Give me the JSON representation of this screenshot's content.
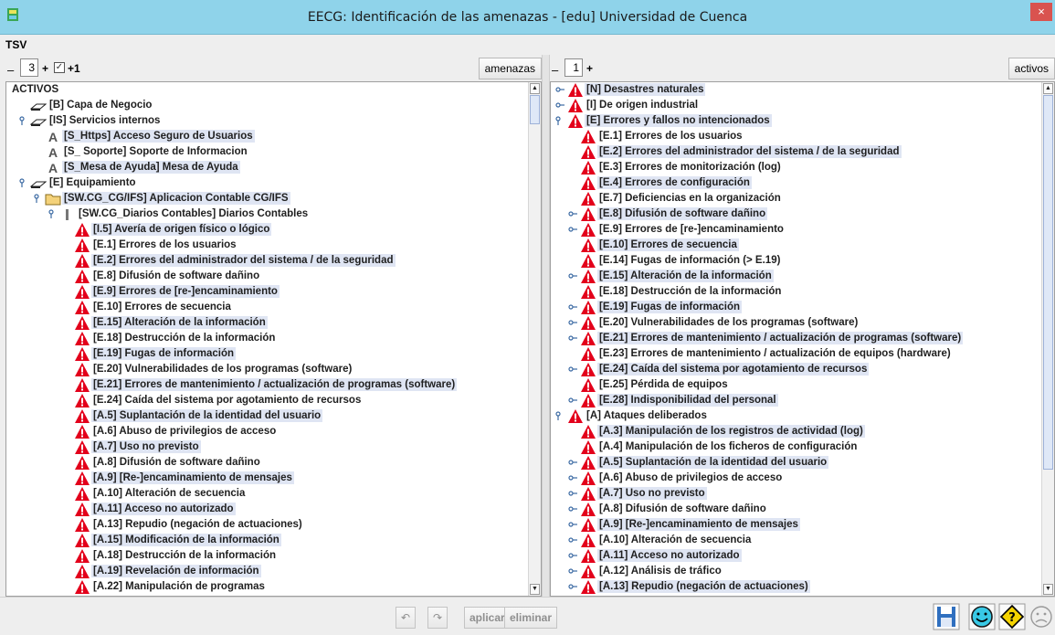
{
  "window": {
    "title": "EECG: Identificación de las amenazas - [edu] Universidad de Cuenca",
    "close_glyph": "×"
  },
  "menubar": {
    "menu": "TSV"
  },
  "left_toolbar": {
    "minus": "–",
    "level": "3",
    "plus": "+",
    "check_glyph": "✓",
    "plus_one": "+1",
    "button": "amenazas"
  },
  "right_toolbar": {
    "minus": "–",
    "level": "1",
    "plus": "+",
    "button": "activos"
  },
  "left_tree": {
    "rows": [
      {
        "label": "ACTIVOS",
        "depth": 0,
        "icon": "none",
        "toggle": "none",
        "hl": false
      },
      {
        "label": "[B] Capa de Negocio",
        "depth": 1,
        "icon": "layer",
        "toggle": "none",
        "hl": false
      },
      {
        "label": "[IS] Servicios internos",
        "depth": 1,
        "icon": "layer",
        "toggle": "open",
        "hl": false
      },
      {
        "label": "[S_Https] Acceso Seguro de Usuarios",
        "depth": 2,
        "icon": "a",
        "toggle": "none",
        "hl": true
      },
      {
        "label": "[S_ Soporte] Soporte de Informacion",
        "depth": 2,
        "icon": "a",
        "toggle": "none",
        "hl": false
      },
      {
        "label": "[S_Mesa de Ayuda] Mesa de Ayuda",
        "depth": 2,
        "icon": "a",
        "toggle": "none",
        "hl": true
      },
      {
        "label": "[E] Equipamiento",
        "depth": 1,
        "icon": "layer",
        "toggle": "open",
        "hl": false
      },
      {
        "label": "[SW.CG_CG/IFS] Aplicacion Contable CG/IFS",
        "depth": 2,
        "icon": "folder",
        "toggle": "open",
        "hl": true
      },
      {
        "label": "[SW.CG_Diarios Contables] Diarios Contables",
        "depth": 3,
        "icon": "bar",
        "toggle": "open",
        "hl": false
      },
      {
        "label": "[I.5] Avería de origen físico o lógico",
        "depth": 4,
        "icon": "warn",
        "toggle": "none",
        "hl": true
      },
      {
        "label": "[E.1] Errores de los usuarios",
        "depth": 4,
        "icon": "warn",
        "toggle": "none",
        "hl": false
      },
      {
        "label": "[E.2] Errores del administrador del sistema / de la seguridad",
        "depth": 4,
        "icon": "warn",
        "toggle": "none",
        "hl": true
      },
      {
        "label": "[E.8] Difusión de software dañino",
        "depth": 4,
        "icon": "warn",
        "toggle": "none",
        "hl": false
      },
      {
        "label": "[E.9] Errores de [re-]encaminamiento",
        "depth": 4,
        "icon": "warn",
        "toggle": "none",
        "hl": true
      },
      {
        "label": "[E.10] Errores de secuencia",
        "depth": 4,
        "icon": "warn",
        "toggle": "none",
        "hl": false
      },
      {
        "label": "[E.15] Alteración de la información",
        "depth": 4,
        "icon": "warn",
        "toggle": "none",
        "hl": true
      },
      {
        "label": "[E.18] Destrucción de la información",
        "depth": 4,
        "icon": "warn",
        "toggle": "none",
        "hl": false
      },
      {
        "label": "[E.19] Fugas de información",
        "depth": 4,
        "icon": "warn",
        "toggle": "none",
        "hl": true
      },
      {
        "label": "[E.20] Vulnerabilidades de los programas (software)",
        "depth": 4,
        "icon": "warn",
        "toggle": "none",
        "hl": false
      },
      {
        "label": "[E.21] Errores de mantenimiento / actualización de programas (software)",
        "depth": 4,
        "icon": "warn",
        "toggle": "none",
        "hl": true
      },
      {
        "label": "[E.24] Caída del sistema por agotamiento de recursos",
        "depth": 4,
        "icon": "warn",
        "toggle": "none",
        "hl": false
      },
      {
        "label": "[A.5] Suplantación de la identidad del usuario",
        "depth": 4,
        "icon": "warn",
        "toggle": "none",
        "hl": true
      },
      {
        "label": "[A.6] Abuso de privilegios de acceso",
        "depth": 4,
        "icon": "warn",
        "toggle": "none",
        "hl": false
      },
      {
        "label": "[A.7] Uso no previsto",
        "depth": 4,
        "icon": "warn",
        "toggle": "none",
        "hl": true
      },
      {
        "label": "[A.8] Difusión de software dañino",
        "depth": 4,
        "icon": "warn",
        "toggle": "none",
        "hl": false
      },
      {
        "label": "[A.9] [Re-]encaminamiento de mensajes",
        "depth": 4,
        "icon": "warn",
        "toggle": "none",
        "hl": true
      },
      {
        "label": "[A.10] Alteración de secuencia",
        "depth": 4,
        "icon": "warn",
        "toggle": "none",
        "hl": false
      },
      {
        "label": "[A.11] Acceso no autorizado",
        "depth": 4,
        "icon": "warn",
        "toggle": "none",
        "hl": true
      },
      {
        "label": "[A.13] Repudio (negación de actuaciones)",
        "depth": 4,
        "icon": "warn",
        "toggle": "none",
        "hl": false
      },
      {
        "label": "[A.15] Modificación de la información",
        "depth": 4,
        "icon": "warn",
        "toggle": "none",
        "hl": true
      },
      {
        "label": "[A.18] Destrucción de la información",
        "depth": 4,
        "icon": "warn",
        "toggle": "none",
        "hl": false
      },
      {
        "label": "[A.19] Revelación de información",
        "depth": 4,
        "icon": "warn",
        "toggle": "none",
        "hl": true
      },
      {
        "label": "[A.22] Manipulación de programas",
        "depth": 4,
        "icon": "warn",
        "toggle": "none",
        "hl": false
      }
    ]
  },
  "right_tree": {
    "rows": [
      {
        "label": "[N] Desastres naturales",
        "depth": 0,
        "icon": "warn",
        "toggle": "closed",
        "hl": true
      },
      {
        "label": "[I] De origen industrial",
        "depth": 0,
        "icon": "warn",
        "toggle": "closed",
        "hl": false
      },
      {
        "label": "[E] Errores y fallos no intencionados",
        "depth": 0,
        "icon": "warn",
        "toggle": "open",
        "hl": true
      },
      {
        "label": "[E.1] Errores de los usuarios",
        "depth": 1,
        "icon": "warn",
        "toggle": "none",
        "hl": false
      },
      {
        "label": "[E.2] Errores del administrador del sistema / de la seguridad",
        "depth": 1,
        "icon": "warn",
        "toggle": "none",
        "hl": true
      },
      {
        "label": "[E.3] Errores de monitorización (log)",
        "depth": 1,
        "icon": "warn",
        "toggle": "none",
        "hl": false
      },
      {
        "label": "[E.4] Errores de configuración",
        "depth": 1,
        "icon": "warn",
        "toggle": "none",
        "hl": true
      },
      {
        "label": "[E.7] Deficiencias en la organización",
        "depth": 1,
        "icon": "warn",
        "toggle": "none",
        "hl": false
      },
      {
        "label": "[E.8] Difusión de software dañino",
        "depth": 1,
        "icon": "warn",
        "toggle": "closed",
        "hl": true
      },
      {
        "label": "[E.9] Errores de [re-]encaminamiento",
        "depth": 1,
        "icon": "warn",
        "toggle": "closed",
        "hl": false
      },
      {
        "label": "[E.10] Errores de secuencia",
        "depth": 1,
        "icon": "warn",
        "toggle": "none",
        "hl": true
      },
      {
        "label": "[E.14] Fugas de información (> E.19)",
        "depth": 1,
        "icon": "warn",
        "toggle": "none",
        "hl": false
      },
      {
        "label": "[E.15] Alteración de la información",
        "depth": 1,
        "icon": "warn",
        "toggle": "closed",
        "hl": true
      },
      {
        "label": "[E.18] Destrucción de la información",
        "depth": 1,
        "icon": "warn",
        "toggle": "none",
        "hl": false
      },
      {
        "label": "[E.19] Fugas de información",
        "depth": 1,
        "icon": "warn",
        "toggle": "closed",
        "hl": true
      },
      {
        "label": "[E.20] Vulnerabilidades de los programas (software)",
        "depth": 1,
        "icon": "warn",
        "toggle": "closed",
        "hl": false
      },
      {
        "label": "[E.21] Errores de mantenimiento / actualización de programas (software)",
        "depth": 1,
        "icon": "warn",
        "toggle": "closed",
        "hl": true
      },
      {
        "label": "[E.23] Errores de mantenimiento / actualización de equipos (hardware)",
        "depth": 1,
        "icon": "warn",
        "toggle": "none",
        "hl": false
      },
      {
        "label": "[E.24] Caída del sistema por agotamiento de recursos",
        "depth": 1,
        "icon": "warn",
        "toggle": "closed",
        "hl": true
      },
      {
        "label": "[E.25] Pérdida de equipos",
        "depth": 1,
        "icon": "warn",
        "toggle": "none",
        "hl": false
      },
      {
        "label": "[E.28] Indisponibilidad del personal",
        "depth": 1,
        "icon": "warn",
        "toggle": "closed",
        "hl": true
      },
      {
        "label": "[A] Ataques deliberados",
        "depth": 0,
        "icon": "warn",
        "toggle": "open",
        "hl": false
      },
      {
        "label": "[A.3] Manipulación de los registros de actividad (log)",
        "depth": 1,
        "icon": "warn",
        "toggle": "none",
        "hl": true
      },
      {
        "label": "[A.4] Manipulación de los ficheros de configuración",
        "depth": 1,
        "icon": "warn",
        "toggle": "none",
        "hl": false
      },
      {
        "label": "[A.5] Suplantación de la identidad del usuario",
        "depth": 1,
        "icon": "warn",
        "toggle": "closed",
        "hl": true
      },
      {
        "label": "[A.6] Abuso de privilegios de acceso",
        "depth": 1,
        "icon": "warn",
        "toggle": "closed",
        "hl": false
      },
      {
        "label": "[A.7] Uso no previsto",
        "depth": 1,
        "icon": "warn",
        "toggle": "closed",
        "hl": true
      },
      {
        "label": "[A.8] Difusión de software dañino",
        "depth": 1,
        "icon": "warn",
        "toggle": "closed",
        "hl": false
      },
      {
        "label": "[A.9] [Re-]encaminamiento de mensajes",
        "depth": 1,
        "icon": "warn",
        "toggle": "closed",
        "hl": true
      },
      {
        "label": "[A.10] Alteración de secuencia",
        "depth": 1,
        "icon": "warn",
        "toggle": "closed",
        "hl": false
      },
      {
        "label": "[A.11] Acceso no autorizado",
        "depth": 1,
        "icon": "warn",
        "toggle": "closed",
        "hl": true
      },
      {
        "label": "[A.12] Análisis de tráfico",
        "depth": 1,
        "icon": "warn",
        "toggle": "closed",
        "hl": false
      },
      {
        "label": "[A.13] Repudio (negación de actuaciones)",
        "depth": 1,
        "icon": "warn",
        "toggle": "closed",
        "hl": true
      }
    ]
  },
  "statusbar": {
    "undo_glyph": "↶",
    "redo_glyph": "↷",
    "apply_label": "aplicar",
    "delete_label": "eliminar"
  },
  "colors": {
    "titlebar": "#8fd3ea",
    "highlight": "#dfe5f3",
    "warning_red": "#e3001b",
    "close": "#d9534f"
  }
}
